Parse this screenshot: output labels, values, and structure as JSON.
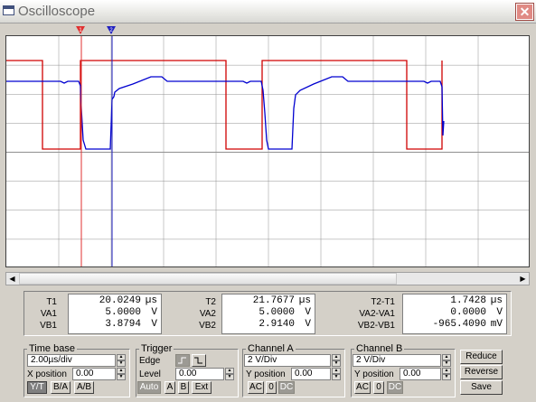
{
  "window": {
    "title": "Oscilloscope",
    "close_glyph": "✕"
  },
  "cursors": {
    "t1_label": "1",
    "t2_label": "2",
    "t1_color": "#e03030",
    "t2_color": "#2020c0"
  },
  "waveforms": {
    "channel_a_color": "#d00000",
    "channel_b_color": "#0000d0",
    "grid_color": "#909090",
    "time_per_div_us": 2.0,
    "volts_per_div": 2
  },
  "readout": {
    "t1": {
      "label": "T1",
      "time": "20.0249",
      "time_unit": "µs",
      "va_label": "VA1",
      "va": "5.0000",
      "va_unit": "V",
      "vb_label": "VB1",
      "vb": "3.8794",
      "vb_unit": "V"
    },
    "t2": {
      "label": "T2",
      "time": "21.7677",
      "time_unit": "µs",
      "va_label": "VA2",
      "va": "5.0000",
      "va_unit": "V",
      "vb_label": "VB2",
      "vb": "2.9140",
      "vb_unit": "V"
    },
    "diff": {
      "label": "T2-T1",
      "time": "1.7428",
      "time_unit": "µs",
      "va_label": "VA2-VA1",
      "va": "0.0000",
      "va_unit": "V",
      "vb_label": "VB2-VB1",
      "vb": "-965.4090",
      "vb_unit": "mV"
    }
  },
  "timebase": {
    "title": "Time base",
    "value": "2.00µs/div",
    "xpos_label": "X position",
    "xpos": "0.00",
    "yt": "Y/T",
    "ba": "B/A",
    "ab": "A/B"
  },
  "trigger": {
    "title": "Trigger",
    "edge_label": "Edge",
    "level_label": "Level",
    "level": "0.00",
    "auto": "Auto",
    "a": "A",
    "b": "B",
    "ext": "Ext"
  },
  "channel_a": {
    "title": "Channel A",
    "value": "2  V/Div",
    "ypos_label": "Y position",
    "ypos": "0.00",
    "ac": "AC",
    "zero": "0",
    "dc": "DC"
  },
  "channel_b": {
    "title": "Channel B",
    "value": "2  V/Div",
    "ypos_label": "Y position",
    "ypos": "0.00",
    "ac": "AC",
    "zero": "0",
    "dc": "DC"
  },
  "buttons": {
    "reduce": "Reduce",
    "reverse": "Reverse",
    "save": "Save"
  },
  "scroll": {
    "left_glyph": "◀",
    "right_glyph": "▶"
  }
}
